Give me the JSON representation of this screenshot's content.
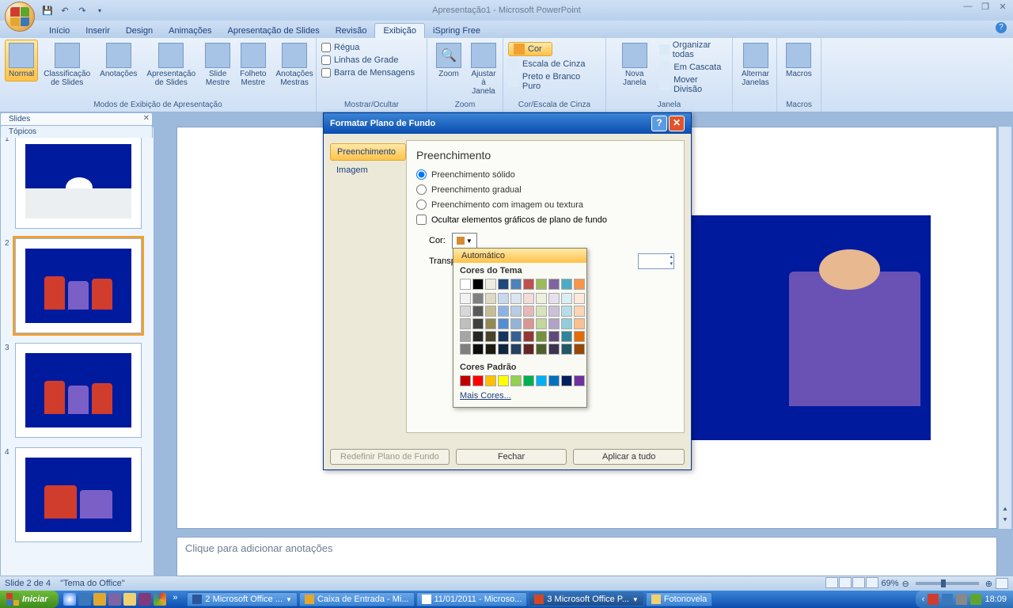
{
  "title": "Apresentação1 - Microsoft PowerPoint",
  "tabs": [
    "Início",
    "Inserir",
    "Design",
    "Animações",
    "Apresentação de Slides",
    "Revisão",
    "Exibição",
    "iSpring Free"
  ],
  "active_tab": 6,
  "ribbon": {
    "views": {
      "label": "Modos de Exibição de Apresentação",
      "items": [
        "Normal",
        "Classificação de Slides",
        "Anotações",
        "Apresentação de Slides",
        "Slide Mestre",
        "Folheto Mestre",
        "Anotações Mestras"
      ]
    },
    "show": {
      "label": "Mostrar/Ocultar",
      "items": [
        "Régua",
        "Linhas de Grade",
        "Barra de Mensagens"
      ]
    },
    "zoom": {
      "label": "Zoom",
      "zoom": "Zoom",
      "fit": "Ajustar à Janela"
    },
    "color": {
      "label": "Cor/Escala de Cinza",
      "btn": "Cor",
      "items": [
        "Escala de Cinza",
        "Preto e Branco Puro"
      ]
    },
    "window": {
      "label": "Janela",
      "new": "Nova Janela",
      "switch": "Alternar Janelas",
      "items": [
        "Organizar todas",
        "Em Cascata",
        "Mover Divisão"
      ]
    },
    "macros": {
      "label": "Macros",
      "btn": "Macros"
    }
  },
  "panel": {
    "slides": "Slides",
    "outline": "Tópicos"
  },
  "notes_placeholder": "Clique para adicionar anotações",
  "status": {
    "slide": "Slide 2 de 4",
    "theme": "\"Tema do Office\"",
    "zoom": "69%"
  },
  "dialog": {
    "title": "Formatar Plano de Fundo",
    "side": [
      "Preenchimento",
      "Imagem"
    ],
    "heading": "Preenchimento",
    "radios": [
      "Preenchimento sólido",
      "Preenchimento gradual",
      "Preenchimento com imagem ou textura"
    ],
    "hide_bg": "Ocultar elementos gráficos de plano de fundo",
    "color_label": "Cor:",
    "transp_label": "Transp",
    "reset": "Redefinir Plano de Fundo",
    "close": "Fechar",
    "apply": "Aplicar a tudo"
  },
  "color_picker": {
    "auto": "Automático",
    "theme": "Cores do Tema",
    "standard": "Cores Padrão",
    "more": "Mais Cores...",
    "theme_row": [
      "#ffffff",
      "#000000",
      "#eeece1",
      "#1f497d",
      "#4f81bd",
      "#c0504d",
      "#9bbb59",
      "#8064a2",
      "#4bacc6",
      "#f79646"
    ],
    "theme_grid": [
      "#f2f2f2",
      "#7f7f7f",
      "#ddd9c3",
      "#c6d9f0",
      "#dbe5f1",
      "#f2dcdb",
      "#ebf1dd",
      "#e5e0ec",
      "#dbeef3",
      "#fdeada",
      "#d8d8d8",
      "#595959",
      "#c4bd97",
      "#8db3e2",
      "#b8cce4",
      "#e5b9b7",
      "#d7e3bc",
      "#ccc1d9",
      "#b7dde8",
      "#fbd5b5",
      "#bfbfbf",
      "#3f3f3f",
      "#938953",
      "#548dd4",
      "#95b3d7",
      "#d99694",
      "#c3d69b",
      "#b2a2c7",
      "#92cddc",
      "#fac08f",
      "#a5a5a5",
      "#262626",
      "#494429",
      "#17365d",
      "#366092",
      "#953734",
      "#76923c",
      "#5f497a",
      "#31859b",
      "#e36c09",
      "#7f7f7f",
      "#0c0c0c",
      "#1d1b10",
      "#0f243e",
      "#244061",
      "#632423",
      "#4f6128",
      "#3f3151",
      "#205867",
      "#974806"
    ],
    "standard_row": [
      "#c00000",
      "#ff0000",
      "#ffc000",
      "#ffff00",
      "#92d050",
      "#00b050",
      "#00b0f0",
      "#0070c0",
      "#002060",
      "#7030a0"
    ]
  },
  "taskbar": {
    "start": "Iniciar",
    "items": [
      "2 Microsoft Office ...",
      "Caixa de Entrada - Mi...",
      "11/01/2011 - Microso...",
      "3 Microsoft Office P...",
      "Fotonovela"
    ],
    "time": "18:09"
  }
}
